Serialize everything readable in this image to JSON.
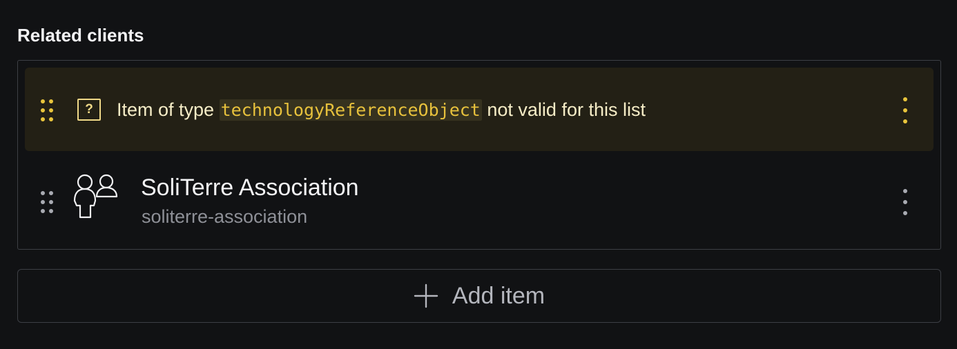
{
  "field": {
    "label": "Related clients"
  },
  "items": {
    "invalid": {
      "prefix": "Item of type ",
      "type_name": "technologyReferenceObject",
      "suffix": " not valid for this list",
      "icon": "question-box-icon",
      "accent_color": "#e9c53c"
    },
    "client": {
      "title": "SoliTerre Association",
      "subtitle": "soliterre-association",
      "icon": "users-icon"
    }
  },
  "add_item": {
    "label": "Add item",
    "icon": "plus-icon"
  }
}
